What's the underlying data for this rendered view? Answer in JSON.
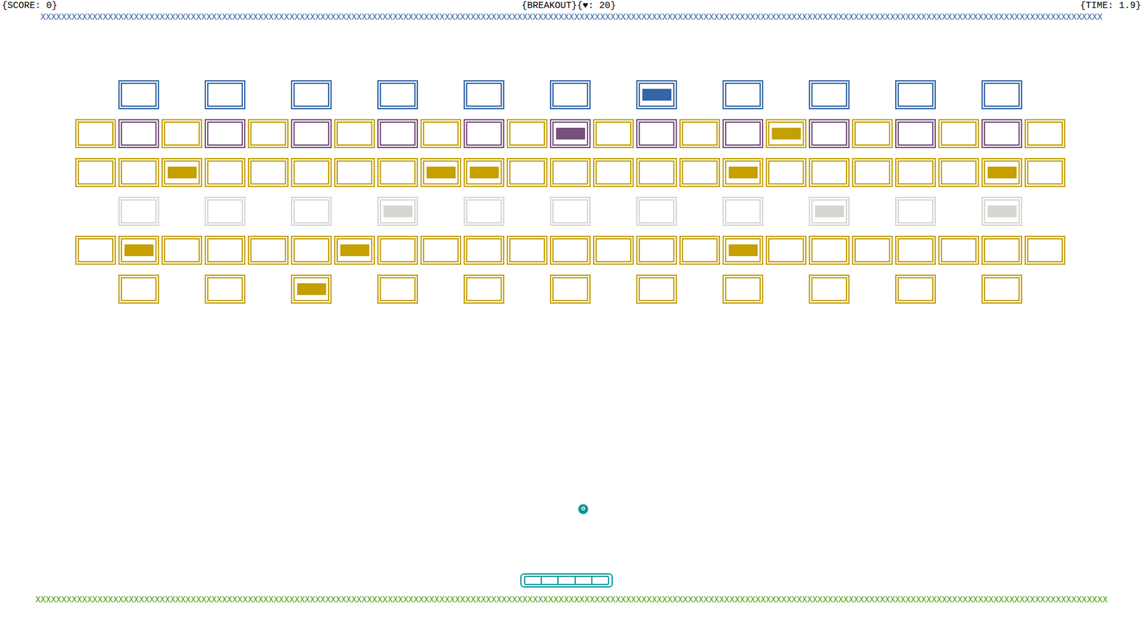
{
  "header": {
    "score": "{SCORE: 0}",
    "title": "{BREAKOUT}",
    "lives": "{♥: 20}",
    "time": "{TIME: 1.9}"
  },
  "top_wall": "XXXXXXXXXXXXXXXXXXXXXXXXXXXXXXXXXXXXXXXXXXXXXXXXXXXXXXXXXXXXXXXXXXXXXXXXXXXXXXXXXXXXXXXXXXXXXXXXXXXXXXXXXXXXXXXXXXXXXXXXXXXXXXXXXXXXXXXXXXXXXXXXXXXXXXXXXXXXXXXXXXXXXXXXXXXXXXXXXXXXXXXXXXXXXXXXXXXXXXXXXXXXX",
  "bottom_wall": "XXXXXXXXXXXXXXXXXXXXXXXXXXXXXXXXXXXXXXXXXXXXXXXXXXXXXXXXXXXXXXXXXXXXXXXXXXXXXXXXXXXXXXXXXXXXXXXXXXXXXXXXXXXXXXXXXXXXXXXXXXXXXXXXXXXXXXXXXXXXXXXXXXXXXXXXXXXXXXXXXXXXXXXXXXXXXXXXXXXXXXXXXXXXXXXXXXXXXXXXXXXXXXX",
  "rows": [
    {
      "bricks": [
        {
          "kind": "gap"
        },
        {
          "kind": "brick",
          "color": "#3465a4",
          "filled": false
        },
        {
          "kind": "gap"
        },
        {
          "kind": "brick",
          "color": "#3465a4",
          "filled": false
        },
        {
          "kind": "gap"
        },
        {
          "kind": "brick",
          "color": "#3465a4",
          "filled": false
        },
        {
          "kind": "gap"
        },
        {
          "kind": "brick",
          "color": "#3465a4",
          "filled": false
        },
        {
          "kind": "gap"
        },
        {
          "kind": "brick",
          "color": "#3465a4",
          "filled": false
        },
        {
          "kind": "gap"
        },
        {
          "kind": "brick",
          "color": "#3465a4",
          "filled": false
        },
        {
          "kind": "gap"
        },
        {
          "kind": "brick",
          "color": "#3465a4",
          "filled": true
        },
        {
          "kind": "gap"
        },
        {
          "kind": "brick",
          "color": "#3465a4",
          "filled": false
        },
        {
          "kind": "gap"
        },
        {
          "kind": "brick",
          "color": "#3465a4",
          "filled": false
        },
        {
          "kind": "gap"
        },
        {
          "kind": "brick",
          "color": "#3465a4",
          "filled": false
        },
        {
          "kind": "gap"
        },
        {
          "kind": "brick",
          "color": "#3465a4",
          "filled": false
        },
        {
          "kind": "gap"
        }
      ]
    },
    {
      "bricks": [
        {
          "kind": "brick",
          "color": "#c4a000",
          "filled": false
        },
        {
          "kind": "brick",
          "color": "#75507b",
          "filled": false
        },
        {
          "kind": "brick",
          "color": "#c4a000",
          "filled": false
        },
        {
          "kind": "brick",
          "color": "#75507b",
          "filled": false
        },
        {
          "kind": "brick",
          "color": "#c4a000",
          "filled": false
        },
        {
          "kind": "brick",
          "color": "#75507b",
          "filled": false
        },
        {
          "kind": "brick",
          "color": "#c4a000",
          "filled": false
        },
        {
          "kind": "brick",
          "color": "#75507b",
          "filled": false
        },
        {
          "kind": "brick",
          "color": "#c4a000",
          "filled": false
        },
        {
          "kind": "brick",
          "color": "#75507b",
          "filled": false
        },
        {
          "kind": "brick",
          "color": "#c4a000",
          "filled": false
        },
        {
          "kind": "brick",
          "color": "#75507b",
          "filled": true
        },
        {
          "kind": "brick",
          "color": "#c4a000",
          "filled": false
        },
        {
          "kind": "brick",
          "color": "#75507b",
          "filled": false
        },
        {
          "kind": "brick",
          "color": "#c4a000",
          "filled": false
        },
        {
          "kind": "brick",
          "color": "#75507b",
          "filled": false
        },
        {
          "kind": "brick",
          "color": "#c4a000",
          "filled": true
        },
        {
          "kind": "brick",
          "color": "#75507b",
          "filled": false
        },
        {
          "kind": "brick",
          "color": "#c4a000",
          "filled": false
        },
        {
          "kind": "brick",
          "color": "#75507b",
          "filled": false
        },
        {
          "kind": "brick",
          "color": "#c4a000",
          "filled": false
        },
        {
          "kind": "brick",
          "color": "#75507b",
          "filled": false
        },
        {
          "kind": "brick",
          "color": "#c4a000",
          "filled": false
        }
      ]
    },
    {
      "bricks": [
        {
          "kind": "brick",
          "color": "#c4a000",
          "filled": false
        },
        {
          "kind": "brick",
          "color": "#c4a000",
          "filled": false
        },
        {
          "kind": "brick",
          "color": "#c4a000",
          "filled": true
        },
        {
          "kind": "brick",
          "color": "#c4a000",
          "filled": false
        },
        {
          "kind": "brick",
          "color": "#c4a000",
          "filled": false
        },
        {
          "kind": "brick",
          "color": "#c4a000",
          "filled": false
        },
        {
          "kind": "brick",
          "color": "#c4a000",
          "filled": false
        },
        {
          "kind": "brick",
          "color": "#c4a000",
          "filled": false
        },
        {
          "kind": "brick",
          "color": "#c4a000",
          "filled": true
        },
        {
          "kind": "brick",
          "color": "#c4a000",
          "filled": true
        },
        {
          "kind": "brick",
          "color": "#c4a000",
          "filled": false
        },
        {
          "kind": "brick",
          "color": "#c4a000",
          "filled": false
        },
        {
          "kind": "brick",
          "color": "#c4a000",
          "filled": false
        },
        {
          "kind": "brick",
          "color": "#c4a000",
          "filled": false
        },
        {
          "kind": "brick",
          "color": "#c4a000",
          "filled": false
        },
        {
          "kind": "brick",
          "color": "#c4a000",
          "filled": true
        },
        {
          "kind": "brick",
          "color": "#c4a000",
          "filled": false
        },
        {
          "kind": "brick",
          "color": "#c4a000",
          "filled": false
        },
        {
          "kind": "brick",
          "color": "#c4a000",
          "filled": false
        },
        {
          "kind": "brick",
          "color": "#c4a000",
          "filled": false
        },
        {
          "kind": "brick",
          "color": "#c4a000",
          "filled": false
        },
        {
          "kind": "brick",
          "color": "#c4a000",
          "filled": true
        },
        {
          "kind": "brick",
          "color": "#c4a000",
          "filled": false
        }
      ]
    },
    {
      "bricks": [
        {
          "kind": "gap"
        },
        {
          "kind": "brick",
          "color": "#d3d7cf",
          "filled": false
        },
        {
          "kind": "gap"
        },
        {
          "kind": "brick",
          "color": "#d3d7cf",
          "filled": false
        },
        {
          "kind": "gap"
        },
        {
          "kind": "brick",
          "color": "#d3d7cf",
          "filled": false
        },
        {
          "kind": "gap"
        },
        {
          "kind": "brick",
          "color": "#d3d7cf",
          "filled": true
        },
        {
          "kind": "gap"
        },
        {
          "kind": "brick",
          "color": "#d3d7cf",
          "filled": false
        },
        {
          "kind": "gap"
        },
        {
          "kind": "brick",
          "color": "#d3d7cf",
          "filled": false
        },
        {
          "kind": "gap"
        },
        {
          "kind": "brick",
          "color": "#d3d7cf",
          "filled": false
        },
        {
          "kind": "gap"
        },
        {
          "kind": "brick",
          "color": "#d3d7cf",
          "filled": false
        },
        {
          "kind": "gap"
        },
        {
          "kind": "brick",
          "color": "#d3d7cf",
          "filled": true
        },
        {
          "kind": "gap"
        },
        {
          "kind": "brick",
          "color": "#d3d7cf",
          "filled": false
        },
        {
          "kind": "gap"
        },
        {
          "kind": "brick",
          "color": "#d3d7cf",
          "filled": true
        },
        {
          "kind": "gap"
        }
      ]
    },
    {
      "bricks": [
        {
          "kind": "brick",
          "color": "#c4a000",
          "filled": false
        },
        {
          "kind": "brick",
          "color": "#c4a000",
          "filled": true
        },
        {
          "kind": "brick",
          "color": "#c4a000",
          "filled": false
        },
        {
          "kind": "brick",
          "color": "#c4a000",
          "filled": false
        },
        {
          "kind": "brick",
          "color": "#c4a000",
          "filled": false
        },
        {
          "kind": "brick",
          "color": "#c4a000",
          "filled": false
        },
        {
          "kind": "brick",
          "color": "#c4a000",
          "filled": true
        },
        {
          "kind": "brick",
          "color": "#c4a000",
          "filled": false
        },
        {
          "kind": "brick",
          "color": "#c4a000",
          "filled": false
        },
        {
          "kind": "brick",
          "color": "#c4a000",
          "filled": false
        },
        {
          "kind": "brick",
          "color": "#c4a000",
          "filled": false
        },
        {
          "kind": "brick",
          "color": "#c4a000",
          "filled": false
        },
        {
          "kind": "brick",
          "color": "#c4a000",
          "filled": false
        },
        {
          "kind": "brick",
          "color": "#c4a000",
          "filled": false
        },
        {
          "kind": "brick",
          "color": "#c4a000",
          "filled": false
        },
        {
          "kind": "brick",
          "color": "#c4a000",
          "filled": true
        },
        {
          "kind": "brick",
          "color": "#c4a000",
          "filled": false
        },
        {
          "kind": "brick",
          "color": "#c4a000",
          "filled": false
        },
        {
          "kind": "brick",
          "color": "#c4a000",
          "filled": false
        },
        {
          "kind": "brick",
          "color": "#c4a000",
          "filled": false
        },
        {
          "kind": "brick",
          "color": "#c4a000",
          "filled": false
        },
        {
          "kind": "brick",
          "color": "#c4a000",
          "filled": false
        },
        {
          "kind": "brick",
          "color": "#c4a000",
          "filled": false
        }
      ]
    },
    {
      "bricks": [
        {
          "kind": "gap"
        },
        {
          "kind": "brick",
          "color": "#c4a000",
          "filled": false
        },
        {
          "kind": "gap"
        },
        {
          "kind": "brick",
          "color": "#c4a000",
          "filled": false
        },
        {
          "kind": "gap"
        },
        {
          "kind": "brick",
          "color": "#c4a000",
          "filled": true
        },
        {
          "kind": "gap"
        },
        {
          "kind": "brick",
          "color": "#c4a000",
          "filled": false
        },
        {
          "kind": "gap"
        },
        {
          "kind": "brick",
          "color": "#c4a000",
          "filled": false
        },
        {
          "kind": "gap"
        },
        {
          "kind": "brick",
          "color": "#c4a000",
          "filled": false
        },
        {
          "kind": "gap"
        },
        {
          "kind": "brick",
          "color": "#c4a000",
          "filled": false
        },
        {
          "kind": "gap"
        },
        {
          "kind": "brick",
          "color": "#c4a000",
          "filled": false
        },
        {
          "kind": "gap"
        },
        {
          "kind": "brick",
          "color": "#c4a000",
          "filled": false
        },
        {
          "kind": "gap"
        },
        {
          "kind": "brick",
          "color": "#c4a000",
          "filled": false
        },
        {
          "kind": "gap"
        },
        {
          "kind": "brick",
          "color": "#c4a000",
          "filled": false
        },
        {
          "kind": "gap"
        }
      ]
    }
  ],
  "ball": {
    "glyph": "o"
  },
  "paddle": {
    "segments": 5
  }
}
